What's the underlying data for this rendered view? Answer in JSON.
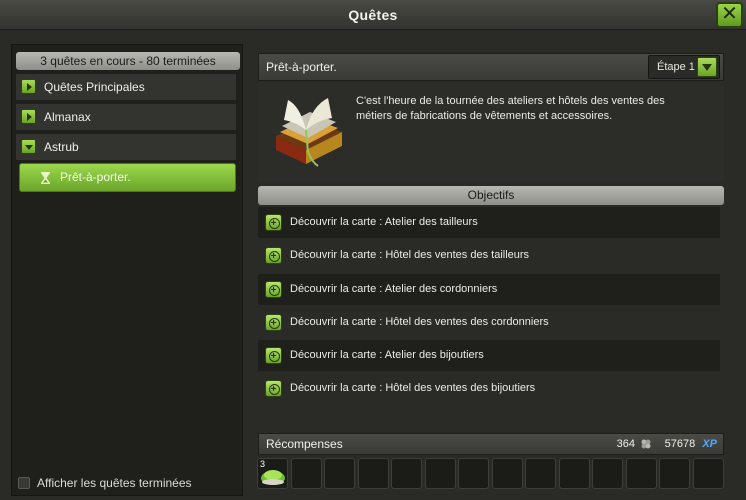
{
  "window": {
    "title": "Quêtes",
    "close_label": "✕"
  },
  "sidebar": {
    "summary": "3 quêtes en cours - 80 terminées",
    "categories": [
      {
        "label": "Quêtes Principales",
        "expanded": false
      },
      {
        "label": "Almanax",
        "expanded": false
      },
      {
        "label": "Astrub",
        "expanded": true
      }
    ],
    "selected_quest": "Prêt-à-porter.",
    "show_finished_label": "Afficher les quêtes terminées",
    "show_finished_checked": false
  },
  "quest": {
    "title": "Prêt-à-porter.",
    "step_label": "Étape 1",
    "description": "C'est l'heure de la tournée des ateliers et hôtels des ventes des métiers de fabrications de vêtements et accessoires.",
    "objectives_header": "Objectifs",
    "objectives": [
      "Découvrir la carte : Atelier des tailleurs",
      "Découvrir la carte : Hôtel des ventes des tailleurs",
      "Découvrir la carte : Atelier des cordonniers",
      "Découvrir la carte : Hôtel des ventes des cordonniers",
      "Découvrir la carte : Atelier des bijoutiers",
      "Découvrir la carte : Hôtel des ventes des bijoutiers"
    ],
    "rewards": {
      "label": "Récompenses",
      "kamas": "364",
      "xp": "57678",
      "xp_label": "XP",
      "first_item_qty": "3"
    }
  },
  "colors": {
    "accent_green": "#8cc63f",
    "xp_blue": "#4fa8ff"
  }
}
